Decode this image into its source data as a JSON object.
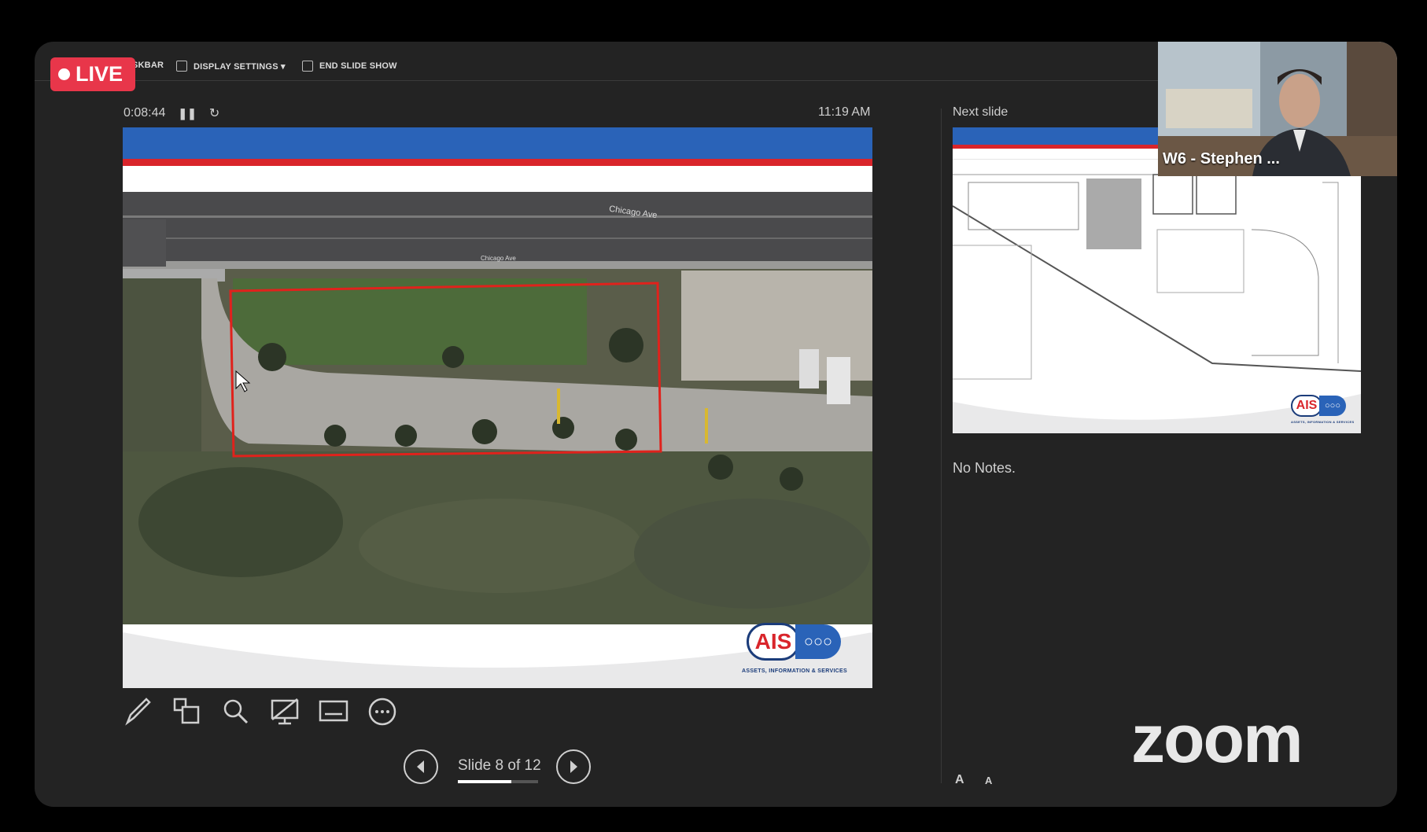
{
  "live_badge": {
    "label": "LIVE"
  },
  "toolbar": {
    "taskbar_label": "SKBAR",
    "display_settings_label": "DISPLAY SETTINGS ▾",
    "end_show_label": "END SLIDE SHOW"
  },
  "presenter": {
    "elapsed_time": "0:08:44",
    "clock": "11:19 AM",
    "next_slide_label": "Next slide",
    "notes": "No Notes.",
    "slide_counter": "Slide 8 of 12",
    "slide_progress": 0.667
  },
  "current_slide": {
    "map_labels": [
      "Chicago Ave",
      "Chicago Ave"
    ],
    "logo_text": "AIS",
    "logo_subtitle": "ASSETS, INFORMATION & SERVICES"
  },
  "next_slide": {
    "logo_text": "AIS",
    "logo_subtitle": "ASSETS, INFORMATION & SERVICES"
  },
  "video": {
    "participant_name": "W6 - Stephen ..."
  },
  "branding": {
    "zoom_logo": "zoom"
  },
  "font_controls": {
    "increase": "A",
    "decrease": "A"
  },
  "colors": {
    "live": "#e8364a",
    "slide_blue": "#2a63b8",
    "slide_red": "#d9252b",
    "selection_rect": "#e0221c"
  }
}
